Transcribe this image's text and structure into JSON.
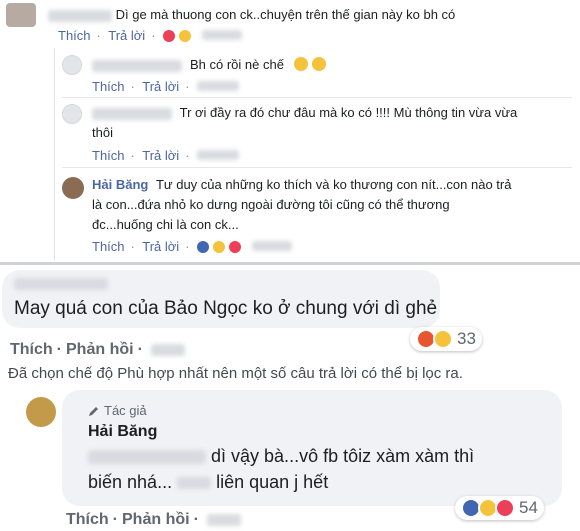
{
  "top": {
    "comment1": {
      "text": "Dì ge mà thuong con ck..chuyện trên thế gian này ko bh có",
      "actions": {
        "like": "Thích",
        "reply": "Trả lời"
      }
    },
    "reply1": {
      "text": "Bh có rồi nè chế",
      "actions": {
        "like": "Thích",
        "reply": "Trả lời"
      }
    },
    "reply2": {
      "text_line1": "Tr ơi đầy ra đó chư đâu mà ko có !!!! Mù thông tin vừa vừa",
      "text_line2": "thôi",
      "actions": {
        "like": "Thích",
        "reply": "Trả lời"
      }
    },
    "reply3": {
      "name": "Hải Băng",
      "text_line1": "Tư duy của những ko thích và ko thương con nít...con nào trả",
      "text_line2": "là con...đứa nhỏ ko dưng ngoài đường tôi cũng có thể thương",
      "text_line3": "đc...huống chi là con ck...",
      "actions": {
        "like": "Thích",
        "reply": "Trả lời"
      }
    }
  },
  "bottom": {
    "comment": {
      "text": "May quá con của Bảo Ngọc ko ở chung với dì ghẻ",
      "reaction_count": "33",
      "actions": {
        "like": "Thích",
        "reply": "Phản hồi"
      }
    },
    "filter_note": "Đã chọn chế độ Phù hợp nhất nên một số câu trả lời có thể bị lọc ra.",
    "author_reply": {
      "badge": "Tác giả",
      "name": "Hải Băng",
      "text_line1": "dì vậy bà...vô fb tôiz xàm xàm thì",
      "text_line2": "biến nhá...",
      "text_line2b": "liên quan j hết",
      "reaction_count": "54",
      "actions": {
        "like": "Thích",
        "reply": "Phản hồi"
      }
    }
  },
  "colors": {
    "link": "#4b67a1",
    "bubble": "#f0f2f5",
    "like": "#4267b2",
    "love": "#ed3f57",
    "haha": "#f5c33b",
    "angry": "#e8562f"
  }
}
